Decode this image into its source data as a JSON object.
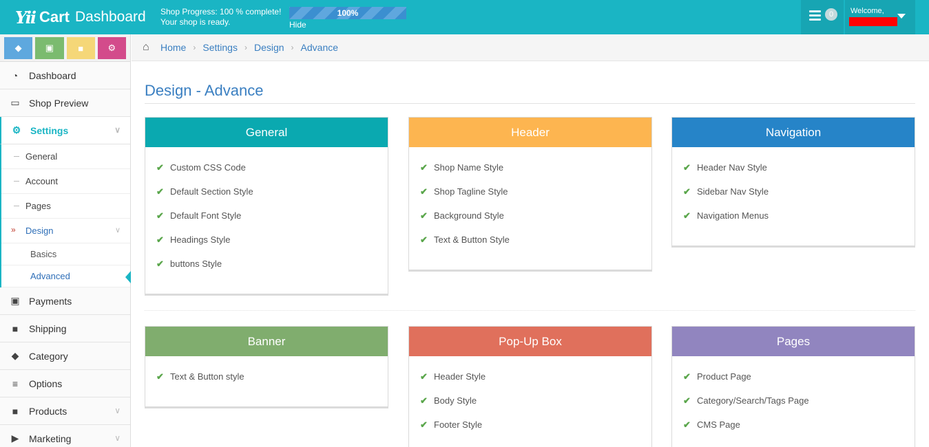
{
  "header": {
    "logo_mark": "Yii",
    "logo_cart": "Cart",
    "logo_dashboard": "Dashboard",
    "progress_line1": "Shop Progress: 100 % complete!",
    "progress_line2": "Your shop is ready.",
    "progress_percent": "100%",
    "progress_value": 1.0,
    "hide_label": "Hide",
    "notification_count": "0",
    "welcome": "Welcome,"
  },
  "shortcuts": [
    {
      "icon": "tag-icon"
    },
    {
      "icon": "money-icon"
    },
    {
      "icon": "cart-icon"
    },
    {
      "icon": "gears-icon"
    }
  ],
  "sidebar": {
    "dashboard": "Dashboard",
    "shop_preview": "Shop Preview",
    "settings": "Settings",
    "settings_sub": {
      "general": "General",
      "account": "Account",
      "pages": "Pages",
      "design": "Design",
      "design_sub": {
        "basics": "Basics",
        "advanced": "Advanced"
      }
    },
    "payments": "Payments",
    "shipping": "Shipping",
    "category": "Category",
    "options": "Options",
    "products": "Products",
    "marketing": "Marketing"
  },
  "breadcrumb": [
    "Home",
    "Settings",
    "Design",
    "Advance"
  ],
  "page_title": "Design - Advance",
  "colors": {
    "topbar": "#1ab5c4",
    "general": "#0aa9b0",
    "header": "#fdb550",
    "navigation": "#2684c8",
    "banner": "#80ad6e",
    "popup": "#e0705c",
    "pages": "#9185bf",
    "check": "#5aa64b"
  },
  "cards": {
    "general": {
      "title": "General",
      "items": [
        "Custom CSS Code",
        "Default Section Style",
        "Default Font Style",
        "Headings Style",
        "buttons Style"
      ]
    },
    "header": {
      "title": "Header",
      "items": [
        "Shop Name Style",
        "Shop Tagline Style",
        "Background Style",
        "Text & Button Style"
      ]
    },
    "navigation": {
      "title": "Navigation",
      "items": [
        "Header Nav Style",
        "Sidebar Nav Style",
        "Navigation Menus"
      ]
    },
    "banner": {
      "title": "Banner",
      "items": [
        "Text & Button style"
      ]
    },
    "popup": {
      "title": "Pop-Up Box",
      "items": [
        "Header Style",
        "Body Style",
        "Footer Style"
      ]
    },
    "pages": {
      "title": "Pages",
      "items": [
        "Product Page",
        "Category/Search/Tags Page",
        "CMS Page"
      ]
    }
  }
}
